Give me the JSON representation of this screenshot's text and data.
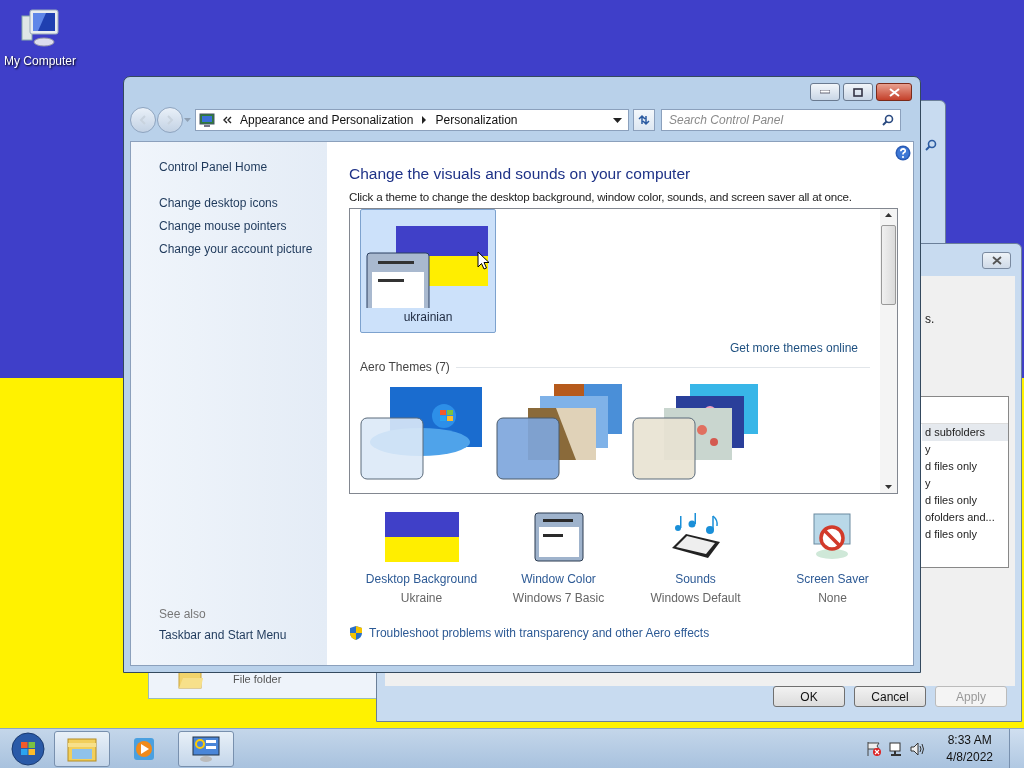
{
  "desktop": {
    "icons": [
      {
        "label": "My Computer"
      }
    ]
  },
  "explorer_window": {
    "type_text": "File folder"
  },
  "properties_dialog": {
    "fragment": "s.",
    "rows": [
      {
        "text": "d subfolders",
        "selected": true
      },
      {
        "text": "y",
        "selected": false
      },
      {
        "text": "d files only",
        "selected": false
      },
      {
        "text": "y",
        "selected": false
      },
      {
        "text": "d files only",
        "selected": false
      },
      {
        "text": "ofolders and...",
        "selected": false
      },
      {
        "text": "d files only",
        "selected": false
      }
    ],
    "buttons": [
      {
        "label": "OK",
        "disabled": false
      },
      {
        "label": "Cancel",
        "disabled": false
      },
      {
        "label": "Apply",
        "disabled": true
      }
    ]
  },
  "window": {
    "breadcrumb": [
      "Appearance and Personalization",
      "Personalization"
    ],
    "search": {
      "placeholder": "Search Control Panel"
    },
    "sidebar": {
      "home": "Control Panel Home",
      "tasks": [
        "Change desktop icons",
        "Change mouse pointers",
        "Change your account picture"
      ],
      "see_also_label": "See also",
      "see_also": [
        "Taskbar and Start Menu"
      ]
    },
    "heading": "Change the visuals and sounds on your computer",
    "description": "Click a theme to change the desktop background, window color, sounds, and screen saver all at once.",
    "my_themes": [
      {
        "name": "ukrainian",
        "selected": true
      }
    ],
    "more_themes_link": "Get more themes online",
    "aero_group": {
      "title": "Aero Themes (7)"
    },
    "settings": [
      {
        "kind": "background",
        "label": "Desktop Background",
        "value": "Ukraine"
      },
      {
        "kind": "color",
        "label": "Window Color",
        "value": "Windows 7 Basic"
      },
      {
        "kind": "sounds",
        "label": "Sounds",
        "value": "Windows Default"
      },
      {
        "kind": "screensaver",
        "label": "Screen Saver",
        "value": "None"
      }
    ],
    "troubleshoot": "Troubleshoot problems with transparency and other Aero effects"
  },
  "taskbar": {
    "apps": [
      {
        "kind": "explorer",
        "active": true
      },
      {
        "kind": "media",
        "active": false
      },
      {
        "kind": "control",
        "active": true
      }
    ],
    "time": "8:33 AM",
    "date": "4/8/2022"
  }
}
